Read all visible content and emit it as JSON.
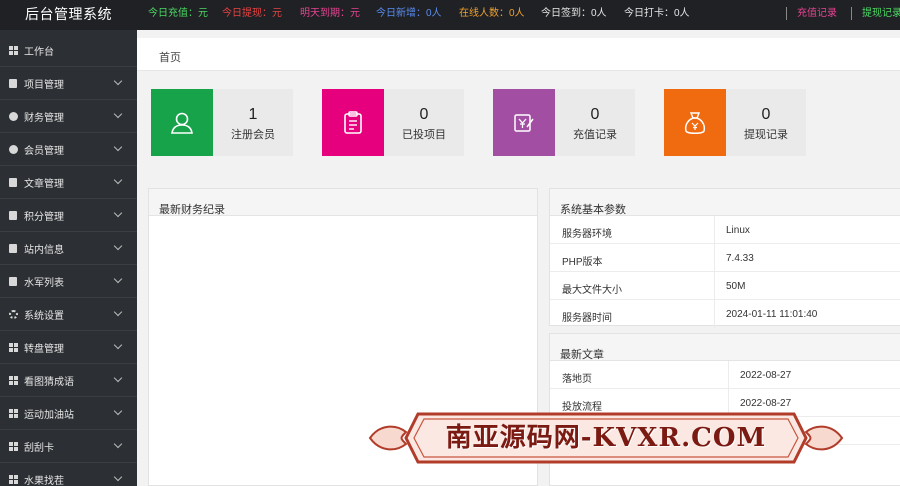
{
  "app": {
    "title": "后台管理系统"
  },
  "topbar": {
    "stats": [
      {
        "label": "今日充值：元",
        "color": "#4cd964"
      },
      {
        "label": "今日提现：元",
        "color": "#e84343"
      },
      {
        "label": "明天到期：元",
        "color": "#e84393"
      },
      {
        "label": "今日新增：0人",
        "color": "#5b8def"
      },
      {
        "label": "在线人数：0人",
        "color": "#f0a030"
      },
      {
        "label": "今日签到：0人",
        "color": "#e6e6e6"
      },
      {
        "label": "今日打卡：0人",
        "color": "#e6e6e6"
      }
    ],
    "links": [
      {
        "label": "充值记录",
        "color": "#e84393"
      },
      {
        "label": "提现记录",
        "color": "#4cd964"
      }
    ]
  },
  "sidebar": {
    "items": [
      {
        "label": "工作台",
        "icon": "grid-icon"
      },
      {
        "label": "项目管理",
        "icon": "file-icon"
      },
      {
        "label": "财务管理",
        "icon": "money-icon"
      },
      {
        "label": "会员管理",
        "icon": "user-icon"
      },
      {
        "label": "文章管理",
        "icon": "file-icon"
      },
      {
        "label": "积分管理",
        "icon": "file-icon"
      },
      {
        "label": "站内信息",
        "icon": "file-icon"
      },
      {
        "label": "水军列表",
        "icon": "file-icon"
      },
      {
        "label": "系统设置",
        "icon": "gear-icon"
      },
      {
        "label": "转盘管理",
        "icon": "grid-icon"
      },
      {
        "label": "看图猜成语",
        "icon": "grid-icon"
      },
      {
        "label": "运动加油站",
        "icon": "grid-icon"
      },
      {
        "label": "刮刮卡",
        "icon": "grid-icon"
      },
      {
        "label": "水果找茬",
        "icon": "grid-icon"
      }
    ]
  },
  "breadcrumb": {
    "home": "首页"
  },
  "cards": [
    {
      "value": "1",
      "label": "注册会员",
      "color": "#16a34a",
      "icon": "user-icon"
    },
    {
      "value": "0",
      "label": "已投项目",
      "color": "#e6007e",
      "icon": "clipboard-icon"
    },
    {
      "value": "0",
      "label": "充值记录",
      "color": "#a24fa3",
      "icon": "yuan-edit-icon"
    },
    {
      "value": "0",
      "label": "提现记录",
      "color": "#f06a0f",
      "icon": "money-bag-icon"
    }
  ],
  "finance_panel": {
    "title": "最新财务纪录"
  },
  "system_panel": {
    "title": "系统基本参数",
    "rows": [
      {
        "key": "服务器环境",
        "value": "Linux"
      },
      {
        "key": "PHP版本",
        "value": "7.4.33"
      },
      {
        "key": "最大文件大小",
        "value": "50M"
      },
      {
        "key": "服务器时间",
        "value": "2024-01-11 11:01:40"
      }
    ]
  },
  "articles_panel": {
    "title": "最新文章",
    "rows": [
      {
        "title": "落地页",
        "date": "2022-08-27"
      },
      {
        "title": "投放流程",
        "date": "2022-08-27"
      }
    ]
  },
  "watermark": {
    "text": "南亚源码网-KVXR.COM"
  }
}
